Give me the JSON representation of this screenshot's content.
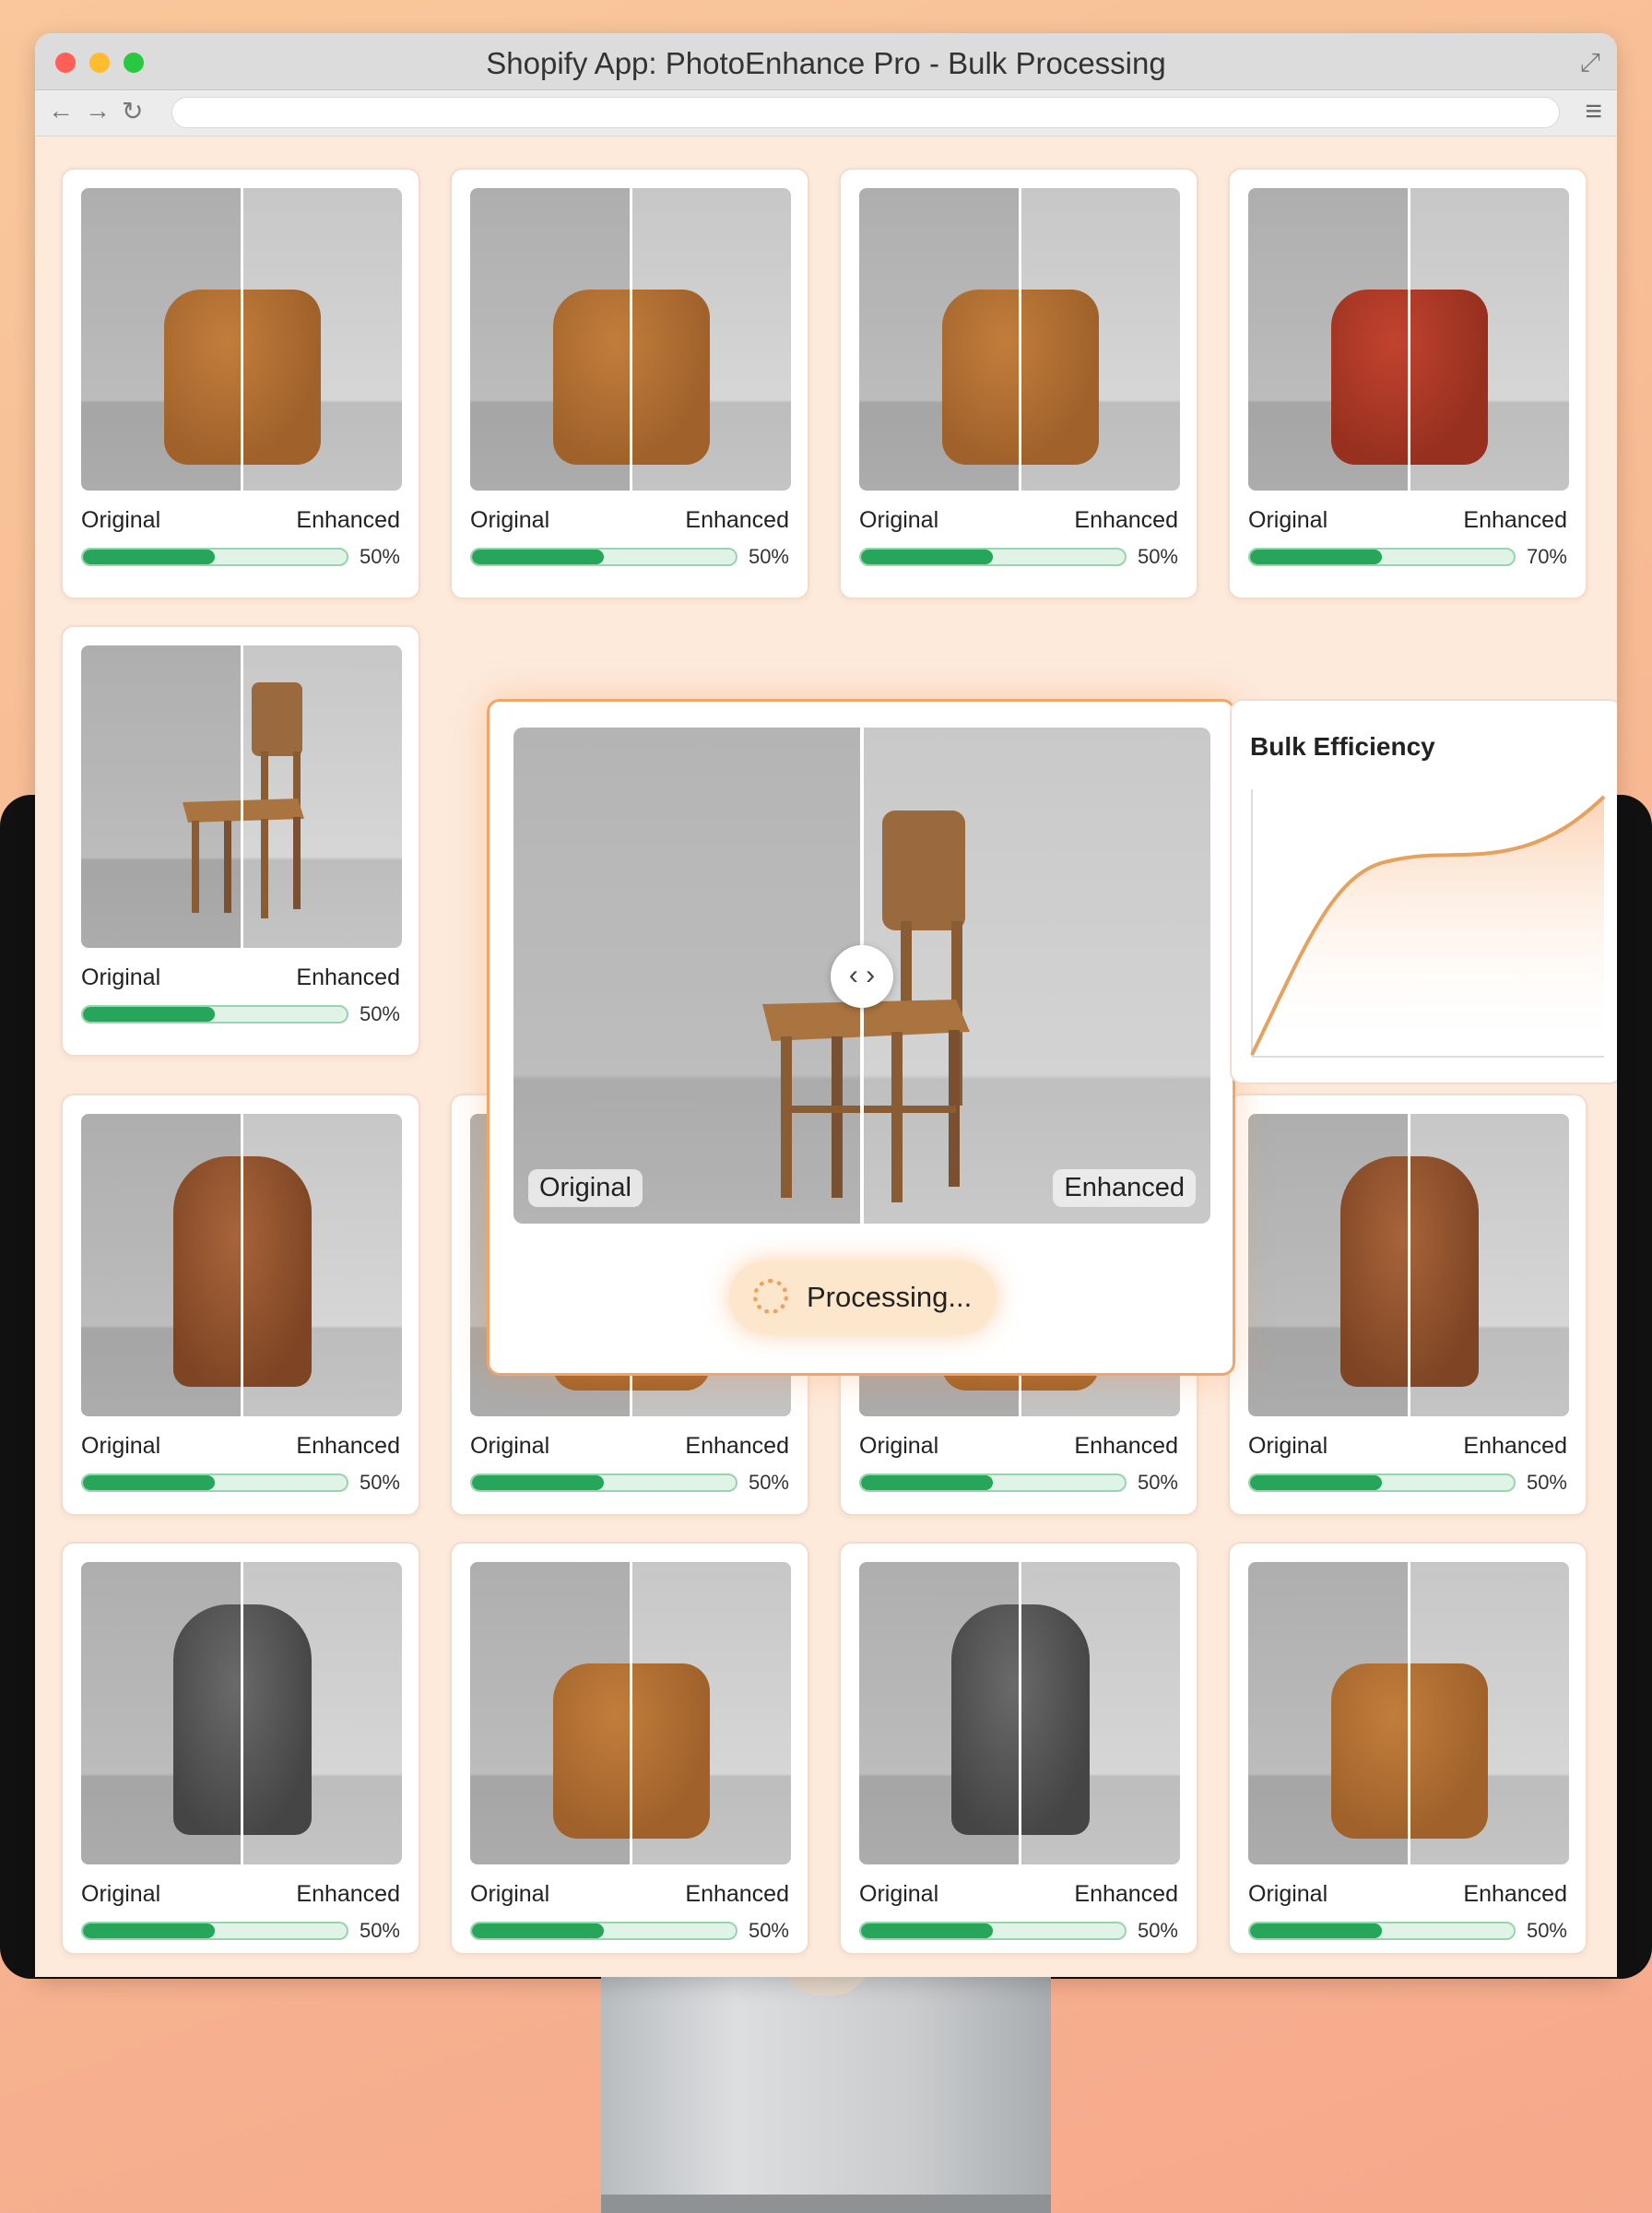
{
  "window": {
    "title": "Shopify App: PhotoEnhance Pro - Bulk Processing",
    "url": ""
  },
  "labels": {
    "original": "Original",
    "enhanced": "Enhanced"
  },
  "cards": [
    {
      "product": "pouf",
      "progress": 50,
      "pct": "50%"
    },
    {
      "product": "pouf",
      "progress": 50,
      "pct": "50%"
    },
    {
      "product": "pouf",
      "progress": 50,
      "pct": "50%"
    },
    {
      "product": "pouf-red",
      "progress": 50,
      "pct": "70%"
    },
    {
      "product": "chair",
      "progress": 50,
      "pct": "50%"
    },
    {
      "product": "backpack",
      "progress": 50,
      "pct": "50%"
    },
    {
      "product": "pouf",
      "progress": 50,
      "pct": "50%"
    },
    {
      "product": "pouf",
      "progress": 50,
      "pct": "50%"
    },
    {
      "product": "backpack",
      "progress": 50,
      "pct": "50%"
    },
    {
      "product": "backpack-grey",
      "progress": 50,
      "pct": "50%"
    },
    {
      "product": "pouf",
      "progress": 50,
      "pct": "50%"
    },
    {
      "product": "backpack-grey",
      "progress": 50,
      "pct": "50%"
    },
    {
      "product": "pouf",
      "progress": 50,
      "pct": "50%"
    }
  ],
  "comparison": {
    "original_tag": "Original",
    "enhanced_tag": "Enhanced",
    "status": "Processing...",
    "handle_icon": "arrows-left-right-icon"
  },
  "efficiency": {
    "title": "Bulk Efficiency"
  },
  "colors": {
    "accent": "#f2a56b",
    "progress": "#27a55a",
    "progress_track": "#dff4e6"
  }
}
